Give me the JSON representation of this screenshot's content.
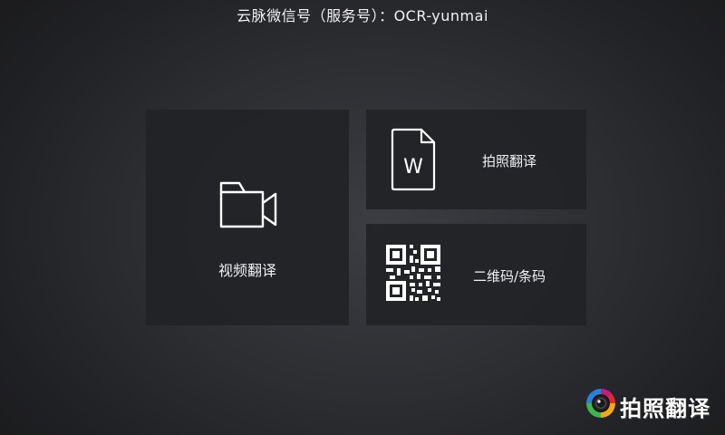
{
  "header": {
    "title": "云脉微信号（服务号）：OCR-yunmai"
  },
  "tiles": {
    "video": {
      "label": "视频翻译",
      "icon": "video-camera-icon"
    },
    "photo": {
      "label": "拍照翻译",
      "icon": "word-document-icon",
      "icon_letter": "W"
    },
    "qr": {
      "label": "二维码/条码",
      "icon": "qr-code-icon"
    }
  },
  "logo": {
    "text": "拍照翻译",
    "icon": "camera-lens-icon"
  }
}
